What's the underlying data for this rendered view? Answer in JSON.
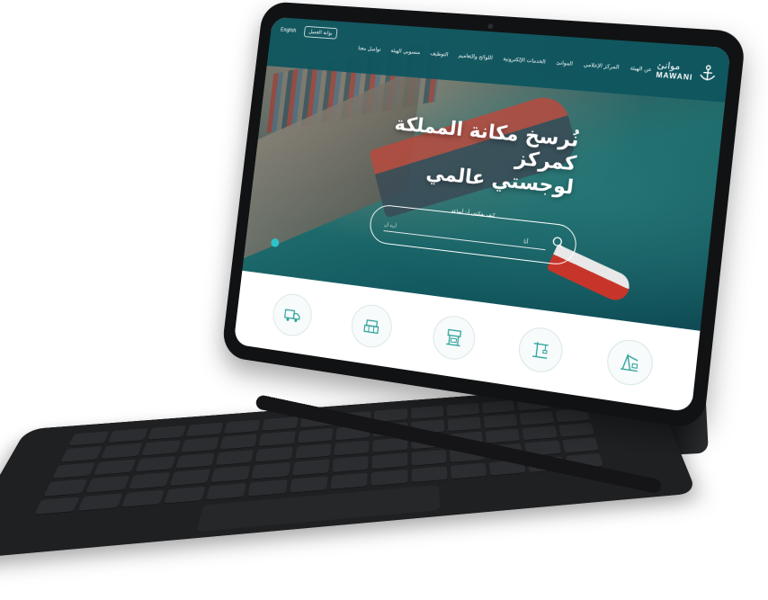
{
  "brand": {
    "logo_ar": "موانئ",
    "logo_en": "MAWANI"
  },
  "topbar": {
    "language": "English",
    "portal_button": "بوابة العميل"
  },
  "nav": {
    "items": [
      "عن الهيئة",
      "المركز الإعلامي",
      "الموانئ",
      "الخدمات الإلكترونية",
      "اللوائح والتعاميم",
      "التوظيف",
      "منسوبي الهيئة",
      "تواصل معنا"
    ]
  },
  "hero": {
    "headline_line1": "نُرسخ مكانة المملكة كمركز",
    "headline_line2": "لوجستي عالمي"
  },
  "search": {
    "question": "كيف يمكنني أن أساعد",
    "placeholder": "أنا",
    "intent": "أريد أن"
  },
  "services": {
    "icons": [
      "box-truck-icon",
      "container-stack-icon",
      "port-terminal-icon",
      "crane-icon",
      "loading-crane-icon"
    ]
  },
  "colors": {
    "nav_bg": "#0e555f",
    "accent": "#2fc3c8",
    "icon": "#2aa198"
  }
}
